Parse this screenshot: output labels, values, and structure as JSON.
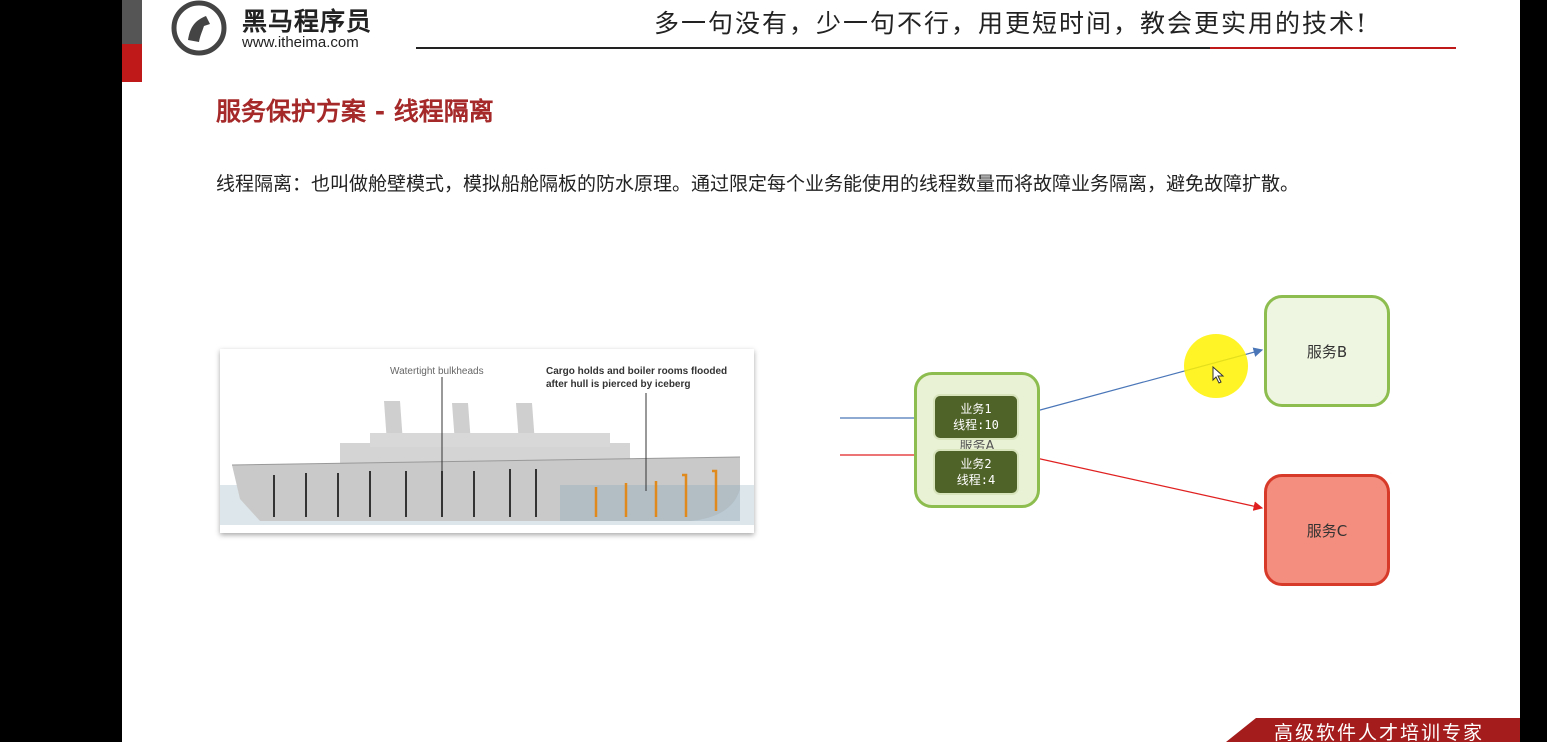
{
  "header": {
    "brand_name": "黑马程序员",
    "brand_url": "www.itheima.com",
    "slogan": "多一句没有，少一句不行，用更短时间，教会更实用的技术!"
  },
  "slide": {
    "title": "服务保护方案 - 线程隔离",
    "description": "线程隔离：也叫做舱壁模式，模拟船舱隔板的防水原理。通过限定每个业务能使用的线程数量而将故障业务隔离，避免故障扩散。"
  },
  "ship_figure": {
    "label_bulkheads": "Watertight bulkheads",
    "label_flooded_line1": "Cargo holds and boiler rooms flooded",
    "label_flooded_line2": "after hull is pierced by iceberg"
  },
  "diagram": {
    "service_a": "服务A",
    "business_1": {
      "name": "业务1",
      "threads": "线程:10"
    },
    "business_2": {
      "name": "业务2",
      "threads": "线程:4"
    },
    "service_b": "服务B",
    "service_c": "服务C",
    "colors": {
      "ok": "#8dbd4f",
      "fail": "#d83a2a",
      "arrow_blue": "#4a76b8",
      "arrow_red": "#e02020"
    }
  },
  "footer": {
    "tagline": "高级软件人才培训专家"
  }
}
